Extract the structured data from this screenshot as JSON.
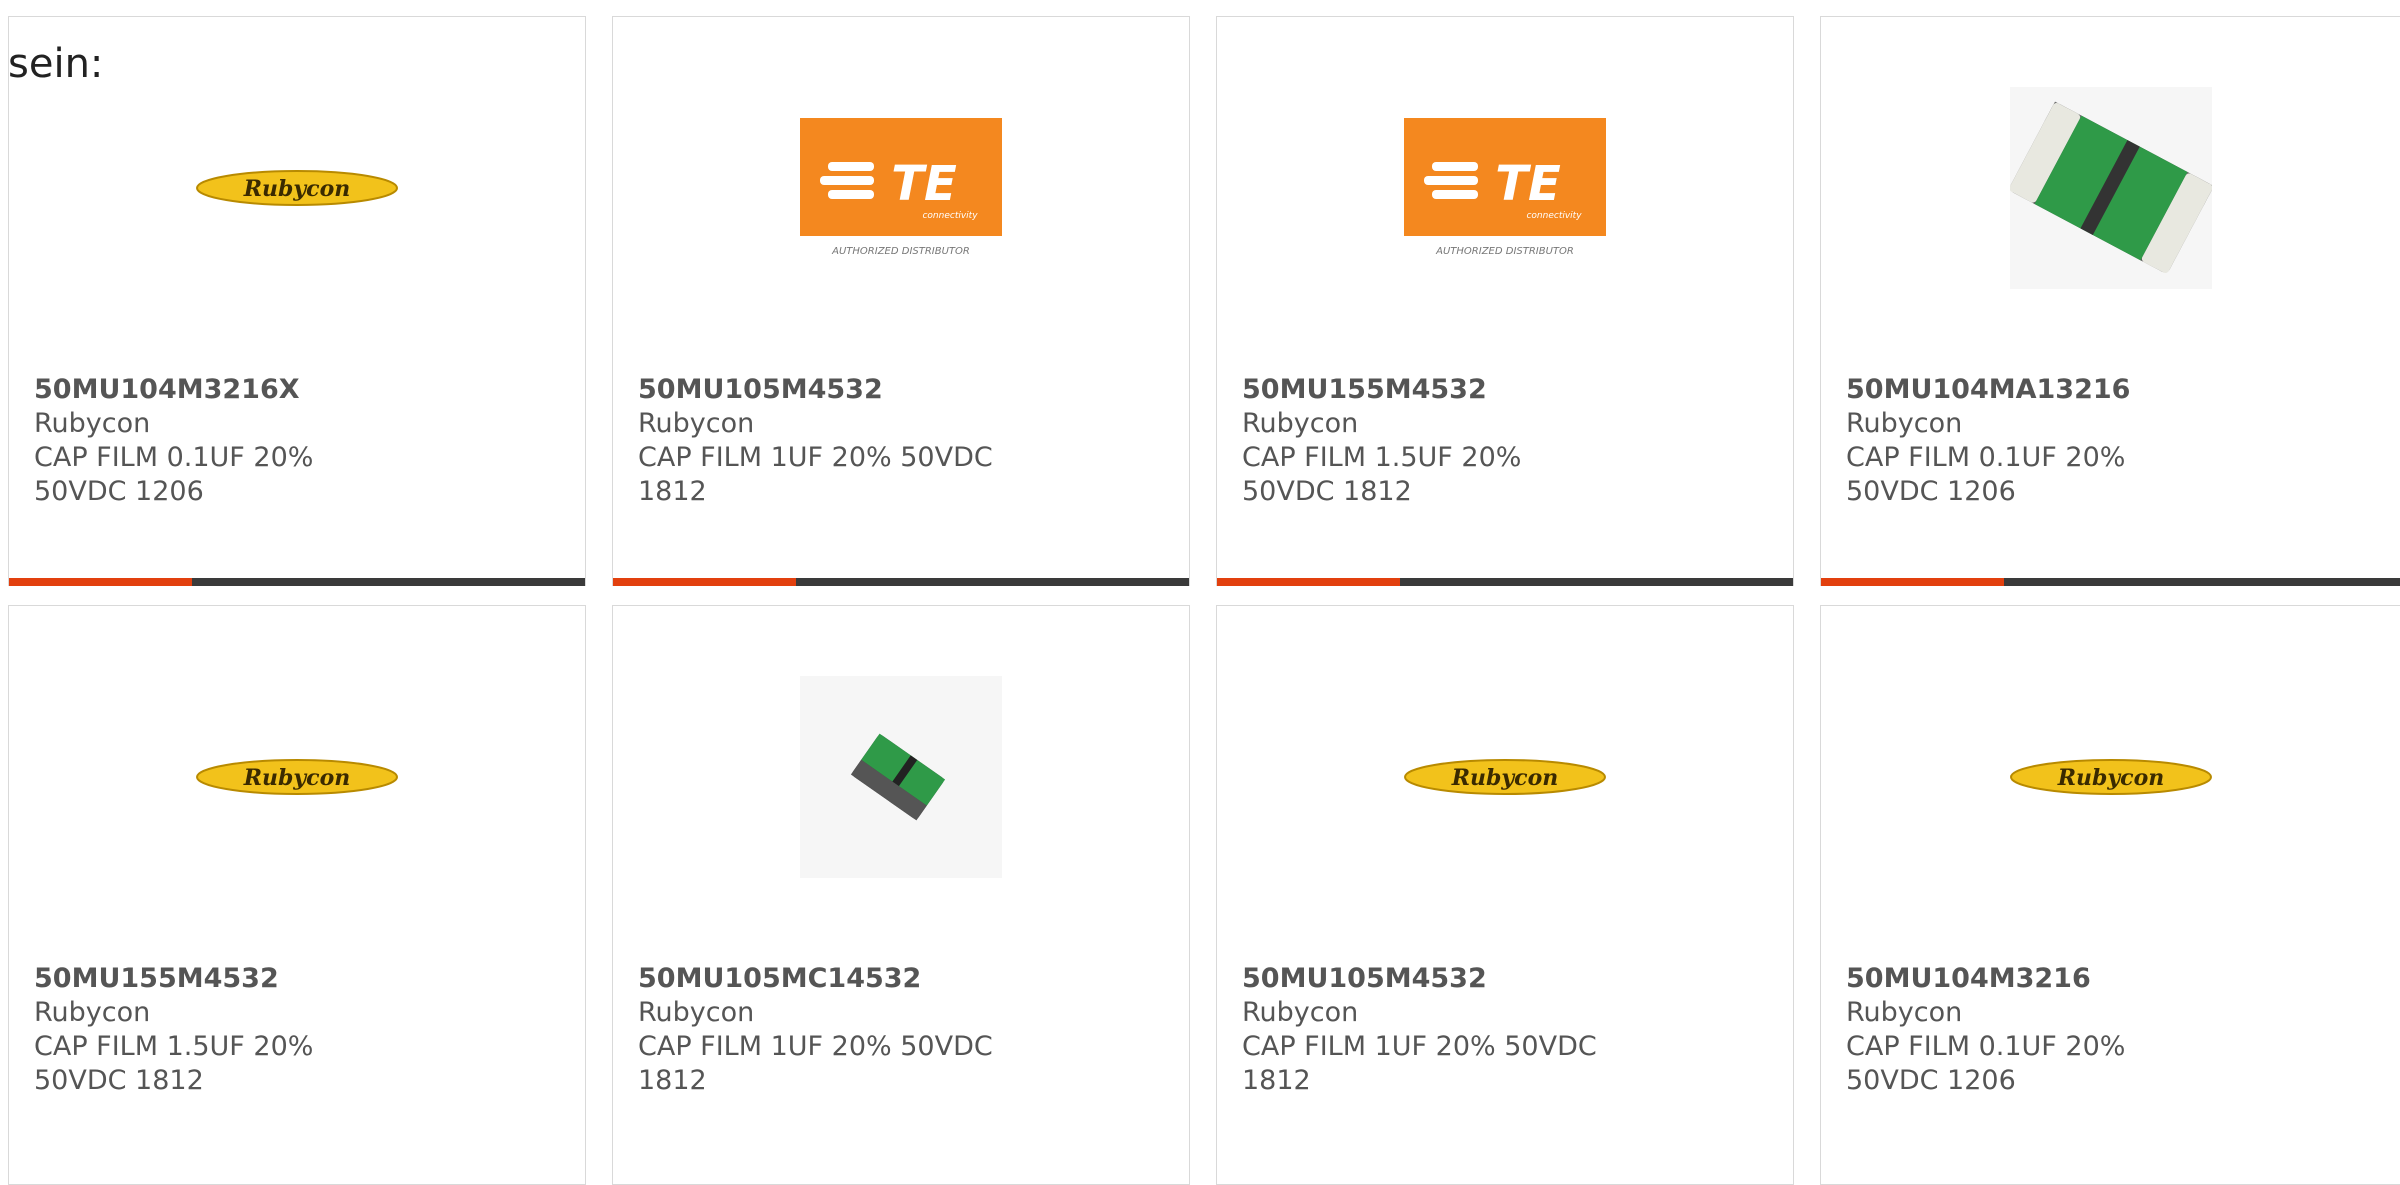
{
  "heading": "sein:",
  "colors": {
    "accent": "#e2400e",
    "bar": "#3a3a3a",
    "border": "#d9d9d9",
    "te_orange": "#f4881f",
    "rubycon_yellow": "#f2c21b"
  },
  "logos": {
    "rubycon": "Rubycon",
    "te_letters": "TE",
    "te_sub": "connectivity",
    "te_authorized": "AUTHORIZED DISTRIBUTOR"
  },
  "products": [
    {
      "part_number": "50MU104M3216X",
      "manufacturer": "Rubycon",
      "description": "CAP FILM 0.1UF 20% 50VDC 1206",
      "image": "rubycon-logo"
    },
    {
      "part_number": "50MU105M4532",
      "manufacturer": "Rubycon",
      "description": "CAP FILM 1UF 20% 50VDC 1812",
      "image": "te-logo"
    },
    {
      "part_number": "50MU155M4532",
      "manufacturer": "Rubycon",
      "description": "CAP FILM 1.5UF 20% 50VDC 1812",
      "image": "te-logo"
    },
    {
      "part_number": "50MU104MA13216",
      "manufacturer": "Rubycon",
      "description": "CAP FILM 0.1UF 20% 50VDC 1206",
      "image": "chip-capacitor-large"
    },
    {
      "part_number": "50MU155M4532",
      "manufacturer": "Rubycon",
      "description": "CAP FILM 1.5UF 20% 50VDC 1812",
      "image": "rubycon-logo"
    },
    {
      "part_number": "50MU105MC14532",
      "manufacturer": "Rubycon",
      "description": "CAP FILM 1UF 20% 50VDC 1812",
      "image": "chip-capacitor-small"
    },
    {
      "part_number": "50MU105M4532",
      "manufacturer": "Rubycon",
      "description": "CAP FILM 1UF 20% 50VDC 1812",
      "image": "rubycon-logo"
    },
    {
      "part_number": "50MU104M3216",
      "manufacturer": "Rubycon",
      "description": "CAP FILM 0.1UF 20% 50VDC 1206",
      "image": "rubycon-logo"
    }
  ]
}
